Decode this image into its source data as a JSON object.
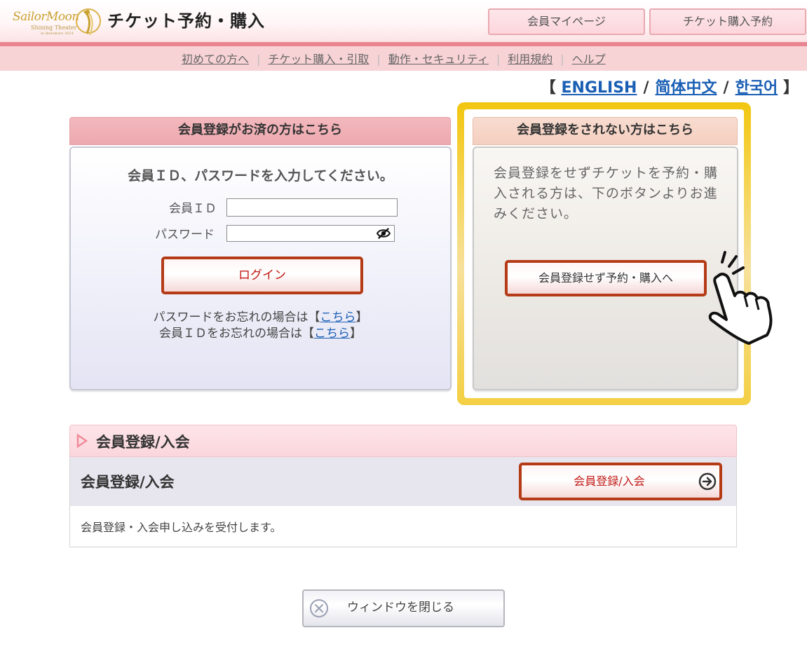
{
  "header": {
    "logo_text": "SailorMoon",
    "logo_subtext": "Shining Theater",
    "logo_small": "in Ikebukuro 2024",
    "title": "チケット予約・購入",
    "mypage_button": "会員マイページ",
    "reservation_button": "チケット購入予約"
  },
  "subnav": {
    "items": [
      {
        "label": "初めての方へ"
      },
      {
        "label": "チケット購入・引取"
      },
      {
        "label": "動作・セキュリティ"
      },
      {
        "label": "利用規約"
      },
      {
        "label": "ヘルプ"
      }
    ]
  },
  "language": {
    "open_bracket": "【",
    "close_bracket": "】",
    "separator": "/",
    "english": "ENGLISH",
    "chinese": "简体中文",
    "korean": "한국어"
  },
  "member_panel": {
    "header": "会員登録がお済の方はこちら",
    "instruction": "会員ＩＤ、パスワードを入力してください。",
    "id_label": "会員ＩＤ",
    "id_value": "",
    "password_label": "パスワード",
    "password_value": "",
    "login_button": "ログイン",
    "forgot_password_prefix": "パスワードをお忘れの場合は【",
    "forgot_id_prefix": "会員ＩＤをお忘れの場合は【",
    "link_text": "こちら",
    "bracket_close": "】"
  },
  "guest_panel": {
    "header": "会員登録をされない方はこちら",
    "description": "会員登録をせずチケットを予約・購入される方は、下のボタンよりお進みください。",
    "button": "会員登録せず予約・購入へ"
  },
  "register_section": {
    "header": "会員登録/入会",
    "row_title": "会員登録/入会",
    "button": "会員登録/入会",
    "description": "会員登録・入会申し込みを受付します。"
  },
  "close_window": {
    "label": "ウィンドウを閉じる"
  },
  "colors": {
    "accent_red": "#b43b16",
    "link_blue": "#1a5fb4",
    "pink_band": "#e8848f",
    "gold_frame": "#f2c60f"
  },
  "icons": [
    "logo-figure",
    "eye-off-icon",
    "pointing-hand-icon",
    "triangle-arrow-icon",
    "circle-arrow-right-icon",
    "close-circle-icon"
  ]
}
